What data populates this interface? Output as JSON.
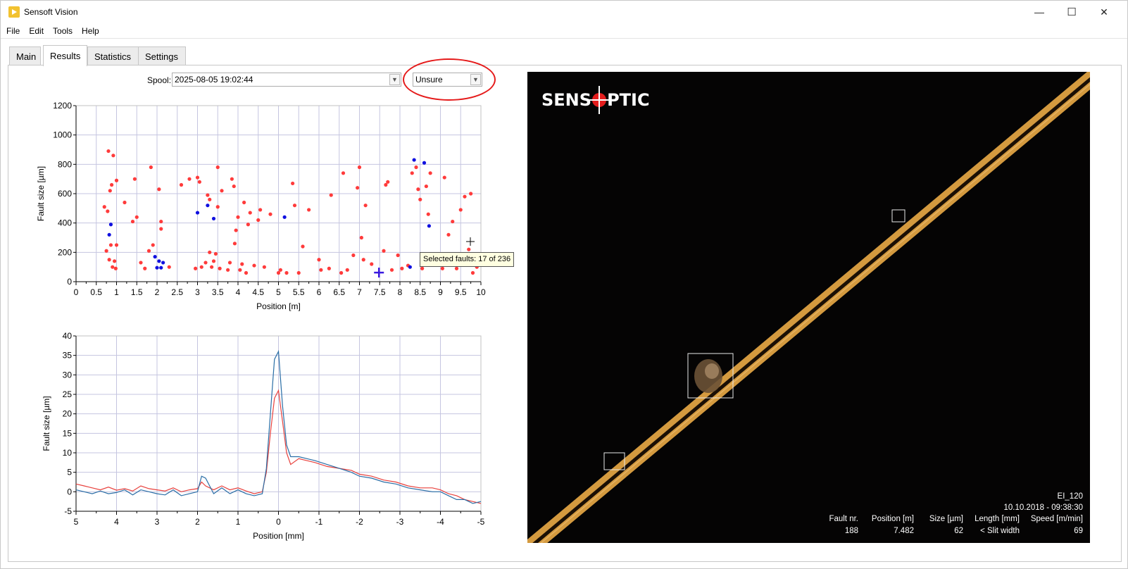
{
  "window": {
    "title": "Sensoft Vision",
    "minimize_glyph": "—",
    "maximize_glyph": "☐",
    "close_glyph": "✕"
  },
  "menu": [
    "File",
    "Edit",
    "Tools",
    "Help"
  ],
  "tabs": [
    {
      "label": "Main",
      "active": false
    },
    {
      "label": "Results",
      "active": true
    },
    {
      "label": "Statistics",
      "active": false
    },
    {
      "label": "Settings",
      "active": false
    }
  ],
  "spool": {
    "label": "Spool:",
    "value": "2025-08-05 19:02:44",
    "filter_value": "Unsure"
  },
  "tooltip": "Selected faults: 17 of 236",
  "colors": {
    "fault_red": "#ff3b3b",
    "fault_blue": "#1010e0",
    "selected_marker": "#3a1ae0",
    "trace_red": "#e8413d",
    "trace_blue": "#2a6ea6",
    "grid": "#c5c5e0",
    "highlight_circle": "#e51b1b"
  },
  "chart_data": [
    {
      "type": "scatter",
      "title": "",
      "xlabel": "Position [m]",
      "ylabel": "Fault size [µm]",
      "xlim": [
        0,
        10
      ],
      "ylim": [
        0,
        1200
      ],
      "xticks": [
        "0",
        "0.5",
        "1",
        "1.5",
        "2",
        "2.5",
        "3",
        "3.5",
        "4",
        "4.5",
        "5",
        "5.5",
        "6",
        "6.5",
        "7",
        "7.5",
        "8",
        "8.5",
        "9",
        "9.5",
        "10"
      ],
      "yticks": [
        "0",
        "200",
        "400",
        "600",
        "800",
        "1000",
        "1200"
      ],
      "grid": true,
      "selected_point": {
        "x": 7.482,
        "y": 62
      },
      "series": [
        {
          "color": "red",
          "points": [
            [
              0.7,
              510
            ],
            [
              0.75,
              210
            ],
            [
              0.78,
              480
            ],
            [
              0.8,
              890
            ],
            [
              0.82,
              150
            ],
            [
              0.84,
              620
            ],
            [
              0.86,
              250
            ],
            [
              0.88,
              660
            ],
            [
              0.9,
              100
            ],
            [
              0.92,
              860
            ],
            [
              0.95,
              140
            ],
            [
              0.98,
              90
            ],
            [
              1.0,
              690
            ],
            [
              1.0,
              250
            ],
            [
              1.2,
              540
            ],
            [
              1.4,
              410
            ],
            [
              1.45,
              700
            ],
            [
              1.5,
              440
            ],
            [
              1.6,
              130
            ],
            [
              1.7,
              90
            ],
            [
              1.8,
              210
            ],
            [
              1.85,
              780
            ],
            [
              1.9,
              250
            ],
            [
              2.05,
              630
            ],
            [
              2.1,
              410
            ],
            [
              2.1,
              360
            ],
            [
              2.3,
              100
            ],
            [
              2.6,
              660
            ],
            [
              2.8,
              700
            ],
            [
              2.95,
              90
            ],
            [
              3.0,
              710
            ],
            [
              3.05,
              680
            ],
            [
              3.1,
              100
            ],
            [
              3.2,
              130
            ],
            [
              3.25,
              590
            ],
            [
              3.3,
              200
            ],
            [
              3.3,
              560
            ],
            [
              3.35,
              100
            ],
            [
              3.4,
              140
            ],
            [
              3.45,
              190
            ],
            [
              3.5,
              510
            ],
            [
              3.5,
              780
            ],
            [
              3.55,
              90
            ],
            [
              3.6,
              620
            ],
            [
              3.75,
              80
            ],
            [
              3.8,
              130
            ],
            [
              3.85,
              700
            ],
            [
              3.9,
              650
            ],
            [
              3.92,
              260
            ],
            [
              3.95,
              350
            ],
            [
              4.0,
              440
            ],
            [
              4.05,
              80
            ],
            [
              4.1,
              120
            ],
            [
              4.15,
              540
            ],
            [
              4.2,
              60
            ],
            [
              4.25,
              390
            ],
            [
              4.3,
              470
            ],
            [
              4.4,
              110
            ],
            [
              4.5,
              420
            ],
            [
              4.55,
              490
            ],
            [
              4.65,
              100
            ],
            [
              4.8,
              460
            ],
            [
              5.0,
              60
            ],
            [
              5.05,
              80
            ],
            [
              5.2,
              60
            ],
            [
              5.35,
              670
            ],
            [
              5.4,
              520
            ],
            [
              5.5,
              60
            ],
            [
              5.6,
              240
            ],
            [
              5.75,
              490
            ],
            [
              6.0,
              150
            ],
            [
              6.05,
              80
            ],
            [
              6.25,
              90
            ],
            [
              6.3,
              590
            ],
            [
              6.55,
              60
            ],
            [
              6.6,
              740
            ],
            [
              6.7,
              80
            ],
            [
              6.85,
              180
            ],
            [
              6.95,
              640
            ],
            [
              7.0,
              780
            ],
            [
              7.05,
              300
            ],
            [
              7.1,
              150
            ],
            [
              7.15,
              520
            ],
            [
              7.3,
              120
            ],
            [
              7.6,
              210
            ],
            [
              7.65,
              660
            ],
            [
              7.7,
              680
            ],
            [
              7.8,
              80
            ],
            [
              7.95,
              180
            ],
            [
              8.05,
              90
            ],
            [
              8.2,
              110
            ],
            [
              8.3,
              740
            ],
            [
              8.4,
              780
            ],
            [
              8.45,
              630
            ],
            [
              8.5,
              560
            ],
            [
              8.55,
              90
            ],
            [
              8.6,
              150
            ],
            [
              8.65,
              650
            ],
            [
              8.7,
              460
            ],
            [
              8.75,
              740
            ],
            [
              8.8,
              150
            ],
            [
              9.05,
              90
            ],
            [
              9.1,
              710
            ],
            [
              9.2,
              320
            ],
            [
              9.3,
              410
            ],
            [
              9.4,
              90
            ],
            [
              9.5,
              490
            ],
            [
              9.6,
              580
            ],
            [
              9.65,
              160
            ],
            [
              9.7,
              220
            ],
            [
              9.75,
              600
            ],
            [
              9.8,
              60
            ],
            [
              9.9,
              100
            ]
          ]
        },
        {
          "color": "blue",
          "points": [
            [
              0.82,
              320
            ],
            [
              0.86,
              390
            ],
            [
              1.95,
              170
            ],
            [
              2.0,
              95
            ],
            [
              2.05,
              140
            ],
            [
              2.1,
              95
            ],
            [
              2.15,
              130
            ],
            [
              3.0,
              470
            ],
            [
              3.25,
              520
            ],
            [
              3.4,
              430
            ],
            [
              5.15,
              440
            ],
            [
              8.25,
              100
            ],
            [
              8.35,
              830
            ],
            [
              8.6,
              810
            ],
            [
              8.72,
              380
            ]
          ]
        }
      ]
    },
    {
      "type": "line",
      "title": "",
      "xlabel": "Position [mm]",
      "ylabel": "Fault size [µm]",
      "xlim": [
        5,
        -5
      ],
      "ylim": [
        -5,
        40
      ],
      "xticks": [
        "5",
        "4",
        "3",
        "2",
        "1",
        "0",
        "-1",
        "-2",
        "-3",
        "-4",
        "-5"
      ],
      "yticks": [
        "-5",
        "0",
        "5",
        "10",
        "15",
        "20",
        "25",
        "30",
        "35",
        "40"
      ],
      "grid": true,
      "series": [
        {
          "color": "red",
          "x": [
            5,
            4.8,
            4.6,
            4.4,
            4.2,
            4.0,
            3.8,
            3.6,
            3.4,
            3.2,
            3.0,
            2.8,
            2.6,
            2.4,
            2.2,
            2.0,
            1.9,
            1.8,
            1.6,
            1.4,
            1.2,
            1.0,
            0.8,
            0.6,
            0.4,
            0.3,
            0.2,
            0.1,
            0.0,
            -0.1,
            -0.2,
            -0.3,
            -0.5,
            -0.7,
            -0.9,
            -1.2,
            -1.5,
            -1.8,
            -2.0,
            -2.3,
            -2.6,
            -2.9,
            -3.2,
            -3.5,
            -3.8,
            -4.0,
            -4.2,
            -4.4,
            -4.6,
            -4.8,
            -5.0
          ],
          "y": [
            2.0,
            1.5,
            1.0,
            0.5,
            1.2,
            0.4,
            0.8,
            0.2,
            1.5,
            0.8,
            0.5,
            0.2,
            1.0,
            0.0,
            0.5,
            0.8,
            2.5,
            1.5,
            0.5,
            1.5,
            0.5,
            1.0,
            0.2,
            -0.5,
            0.0,
            5.0,
            15.0,
            24.0,
            26.0,
            18.0,
            10.0,
            7.0,
            8.5,
            8.0,
            7.5,
            6.5,
            6.0,
            5.5,
            4.5,
            4.0,
            3.0,
            2.5,
            1.5,
            1.0,
            1.0,
            0.5,
            -0.5,
            -1.0,
            -2.0,
            -2.5,
            -3.0
          ]
        },
        {
          "color": "blue",
          "x": [
            5,
            4.8,
            4.6,
            4.4,
            4.2,
            4.0,
            3.8,
            3.6,
            3.4,
            3.2,
            3.0,
            2.8,
            2.6,
            2.4,
            2.2,
            2.0,
            1.9,
            1.8,
            1.6,
            1.4,
            1.2,
            1.0,
            0.8,
            0.6,
            0.4,
            0.3,
            0.2,
            0.1,
            0.0,
            -0.1,
            -0.2,
            -0.3,
            -0.5,
            -0.7,
            -0.9,
            -1.2,
            -1.5,
            -1.8,
            -2.0,
            -2.3,
            -2.6,
            -2.9,
            -3.2,
            -3.5,
            -3.8,
            -4.0,
            -4.2,
            -4.4,
            -4.6,
            -4.8,
            -5.0
          ],
          "y": [
            0.5,
            0.0,
            -0.5,
            0.2,
            -0.5,
            -0.2,
            0.5,
            -0.8,
            0.5,
            0.0,
            -0.5,
            -0.8,
            0.5,
            -1.0,
            -0.5,
            0.0,
            4.0,
            3.5,
            -0.5,
            1.0,
            -0.5,
            0.5,
            -0.5,
            -1.0,
            -0.5,
            6.0,
            20.0,
            34.0,
            36.0,
            22.0,
            12.0,
            9.0,
            9.0,
            8.5,
            8.0,
            7.0,
            6.0,
            5.0,
            4.0,
            3.5,
            2.5,
            2.0,
            1.0,
            0.5,
            0.0,
            0.0,
            -1.0,
            -2.0,
            -2.0,
            -3.0,
            -2.5
          ]
        }
      ]
    }
  ],
  "camera": {
    "brand_left": "SENS",
    "brand_right": "PTIC",
    "id": "EI_120",
    "datetime": "10.10.2018 - 09:38:30",
    "columns": [
      {
        "header": "Fault nr.",
        "value": "188"
      },
      {
        "header": "Position [m]",
        "value": "7.482"
      },
      {
        "header": "Size [µm]",
        "value": "62"
      },
      {
        "header": "Length [mm]",
        "value": "< Slit width"
      },
      {
        "header": "Speed [m/min]",
        "value": "69"
      }
    ]
  }
}
